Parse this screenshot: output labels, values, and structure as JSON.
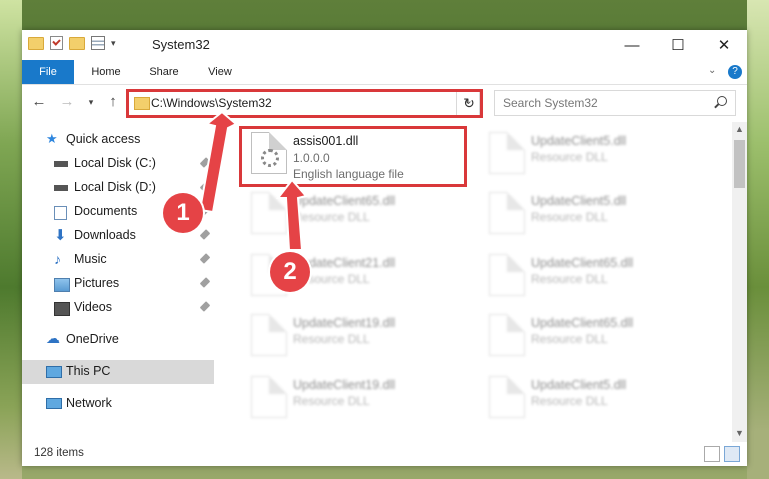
{
  "window": {
    "title": "System32",
    "minimize_icon": "minimize-icon",
    "maximize_icon": "maximize-icon",
    "close_icon": "close-icon"
  },
  "ribbon": {
    "tabs": [
      "File",
      "Home",
      "Share",
      "View"
    ],
    "accent": "#1979ca"
  },
  "address": {
    "path": "C:\\Windows\\System32",
    "search_placeholder": "Search System32"
  },
  "sidebar": {
    "items": [
      {
        "label": "Quick access",
        "icon": "star-icon"
      },
      {
        "label": "Local Disk (C:)",
        "icon": "drive-icon"
      },
      {
        "label": "Local Disk (D:)",
        "icon": "drive-icon"
      },
      {
        "label": "Documents",
        "icon": "documents-icon"
      },
      {
        "label": "Downloads",
        "icon": "download-icon"
      },
      {
        "label": "Music",
        "icon": "music-icon"
      },
      {
        "label": "Pictures",
        "icon": "pictures-icon"
      },
      {
        "label": "Videos",
        "icon": "videos-icon"
      },
      {
        "label": "OneDrive",
        "icon": "cloud-icon"
      },
      {
        "label": "This PC",
        "icon": "computer-icon"
      },
      {
        "label": "Network",
        "icon": "network-icon"
      }
    ]
  },
  "files": {
    "highlighted": {
      "name": "assis001.dll",
      "version": "1.0.0.0",
      "type": "English language file"
    },
    "blurred": [
      {
        "name": "UpdateClient5.dll",
        "type": "Resource DLL"
      },
      {
        "name": "UpdateClient65.dll",
        "type": "Resource DLL"
      },
      {
        "name": "UpdateClient5.dll",
        "type": "Resource DLL"
      },
      {
        "name": "UpdateClient21.dll",
        "type": "Resource DLL"
      },
      {
        "name": "UpdateClient65.dll",
        "type": "Resource DLL"
      },
      {
        "name": "UpdateClient19.dll",
        "type": "Resource DLL"
      },
      {
        "name": "UpdateClient65.dll",
        "type": "Resource DLL"
      },
      {
        "name": "UpdateClient19.dll",
        "type": "Resource DLL"
      },
      {
        "name": "UpdateClient5.dll",
        "type": "Resource DLL"
      }
    ]
  },
  "status": {
    "count": "128 items"
  },
  "markers": [
    "1",
    "2"
  ],
  "highlight_color": "#d9383a"
}
